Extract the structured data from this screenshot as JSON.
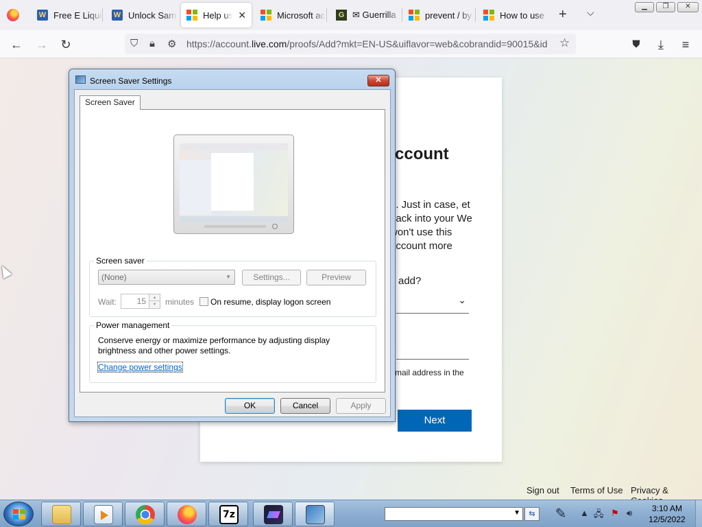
{
  "browser": {
    "tabs": [
      {
        "label": "Free E Liqui",
        "favicon": "wordpress-icon",
        "active": false
      },
      {
        "label": "Unlock Sam",
        "favicon": "wordpress-icon",
        "active": false
      },
      {
        "label": "Help us p",
        "favicon": "microsoft-icon",
        "active": true
      },
      {
        "label": "Microsoft ac",
        "favicon": "microsoft-icon",
        "active": false
      },
      {
        "label": "✉ Guerrilla",
        "favicon": "guerrilla-icon",
        "active": false
      },
      {
        "label": "prevent / by",
        "favicon": "microsoft-icon",
        "active": false
      },
      {
        "label": "How to use",
        "favicon": "microsoft-icon",
        "active": false
      }
    ],
    "url_prefix": "https://account.",
    "url_domain": "live.com",
    "url_suffix": "/proofs/Add?mkt=EN-US&uiflavor=web&cobrandid=90015&id"
  },
  "page": {
    "heading_fragment": "ccount",
    "para_fragment": "n. Just in case, et back into your We won't use this account more",
    "question_fragment": "add?",
    "hint_fragment": "mail address in the",
    "next_label": "Next",
    "footer": {
      "sign_out": "Sign out",
      "terms": "Terms of Use",
      "privacy": "Privacy & Cookies"
    }
  },
  "dialog": {
    "title": "Screen Saver Settings",
    "tab": "Screen Saver",
    "screen_saver_group": "Screen saver",
    "screen_saver_value": "(None)",
    "settings_label": "Settings...",
    "preview_label": "Preview",
    "wait_label": "Wait:",
    "wait_value": "15",
    "minutes_label": "minutes",
    "resume_label": "On resume, display logon screen",
    "power_group": "Power management",
    "power_text": "Conserve energy or maximize performance by adjusting display brightness and other power settings.",
    "power_link": "Change power settings",
    "ok_label": "OK",
    "cancel_label": "Cancel",
    "apply_label": "Apply"
  },
  "taskbar": {
    "time": "3:10 AM",
    "date": "12/5/2022"
  }
}
